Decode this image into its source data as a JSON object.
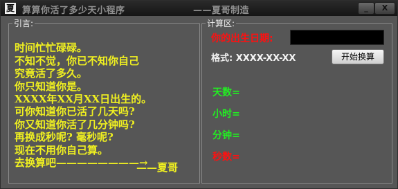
{
  "app_icon": "夏",
  "title": "算算你活了多少天小程序",
  "subtitle": "——夏哥制造",
  "window_controls": {
    "minimize": "_",
    "close": "X"
  },
  "quote_group": {
    "label": "引言:",
    "lines": [
      "时间忙忙碌碌。",
      "不知不觉，你已不知你自己",
      "究竟活了多久。",
      "你只知道你是。",
      "XXXX年XX月XX日出生的。",
      "可你知道你已活了几天吗?",
      "你又知道你活了几分钟吗?",
      "再换成秒呢? 毫秒呢?",
      "现在不用你自己算。",
      "去换算吧————————→"
    ],
    "signature": "——夏哥"
  },
  "calc_group": {
    "label": "计算区:",
    "dob_label": "你的出生日期:",
    "dob_value": "",
    "format_label": "格式: XXXX-XX-XX",
    "start_button": "开始换算",
    "results": {
      "days": "天数=",
      "hours": "小时=",
      "minutes": "分钟=",
      "seconds": "秒数="
    }
  },
  "colors": {
    "quote_text": "#f0f020",
    "red_label": "#ff1010",
    "green_label": "#22ee22",
    "window_bg": "#565656"
  }
}
